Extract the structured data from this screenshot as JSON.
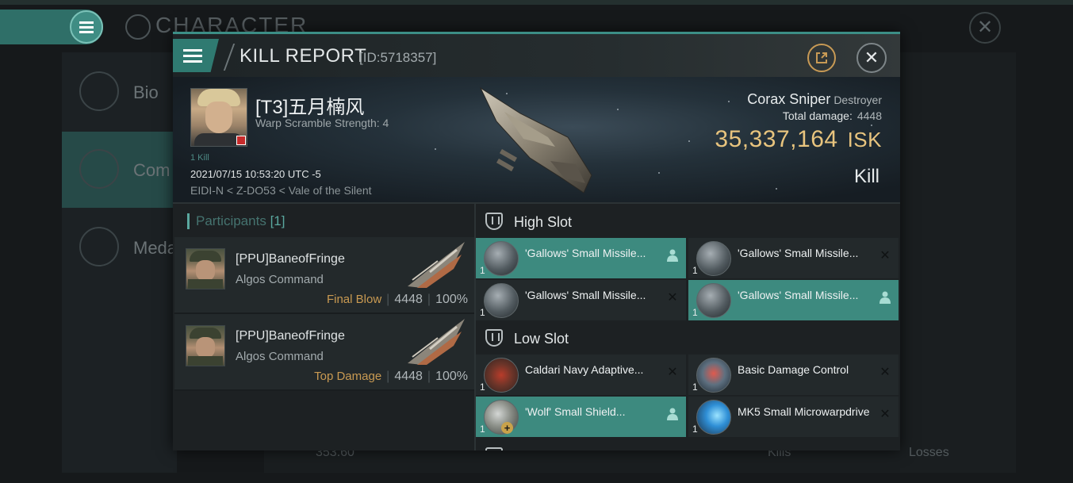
{
  "background": {
    "title": "CHARACTER",
    "sidebar": [
      "Bio",
      "Com",
      "Meda"
    ],
    "bottom_left_value": "353.60",
    "bottom_kills": "Kills",
    "bottom_losses": "Losses"
  },
  "header": {
    "title": "KILL REPORT",
    "id": "[ID:5718357]"
  },
  "victim": {
    "name": "[T3]五月楠风",
    "subtitle": "Warp Scramble Strength: 4",
    "kill_count": "1 Kill",
    "timestamp": "2021/07/15 10:53:20 UTC -5",
    "location": "EIDI-N < Z-DO53 < Vale of the Silent",
    "ship_name": "Corax Sniper",
    "ship_class": "Destroyer",
    "total_damage_label": "Total damage:",
    "total_damage": "4448",
    "isk_value": "35,337,164",
    "isk_unit": "ISK",
    "result": "Kill"
  },
  "participants": {
    "label": "Participants",
    "count": "[1]",
    "rows": [
      {
        "name": "[PPU]BaneofFringe",
        "ship": "Algos Command",
        "tag": "Final Blow",
        "damage": "4448",
        "percent": "100%"
      },
      {
        "name": "[PPU]BaneofFringe",
        "ship": "Algos Command",
        "tag": "Top Damage",
        "damage": "4448",
        "percent": "100%"
      }
    ]
  },
  "fitting": {
    "high_slot_label": "High Slot",
    "low_slot_label": "Low Slot",
    "high_slot": [
      {
        "name": "'Gallows' Small Missile...",
        "qty": "1",
        "status": "dropped",
        "highlight": true,
        "icon": "missile-launcher-icon"
      },
      {
        "name": "'Gallows' Small Missile...",
        "qty": "1",
        "status": "destroyed",
        "highlight": false,
        "icon": "missile-launcher-icon"
      },
      {
        "name": "'Gallows' Small Missile...",
        "qty": "1",
        "status": "destroyed",
        "highlight": false,
        "icon": "missile-launcher-icon"
      },
      {
        "name": "'Gallows' Small Missile...",
        "qty": "1",
        "status": "dropped",
        "highlight": true,
        "icon": "missile-launcher-icon"
      }
    ],
    "low_slot": [
      {
        "name": "Caldari Navy Adaptive...",
        "qty": "1",
        "status": "destroyed",
        "highlight": false,
        "icon": "adaptive-hardener-icon"
      },
      {
        "name": "Basic Damage Control",
        "qty": "1",
        "status": "destroyed",
        "highlight": false,
        "icon": "damage-control-icon"
      },
      {
        "name": "'Wolf' Small Shield...",
        "qty": "1",
        "status": "dropped",
        "highlight": true,
        "icon": "shield-extender-icon"
      },
      {
        "name": "MK5 Small Microwarpdrive",
        "qty": "1",
        "status": "destroyed",
        "highlight": false,
        "icon": "microwarpdrive-icon"
      }
    ]
  }
}
